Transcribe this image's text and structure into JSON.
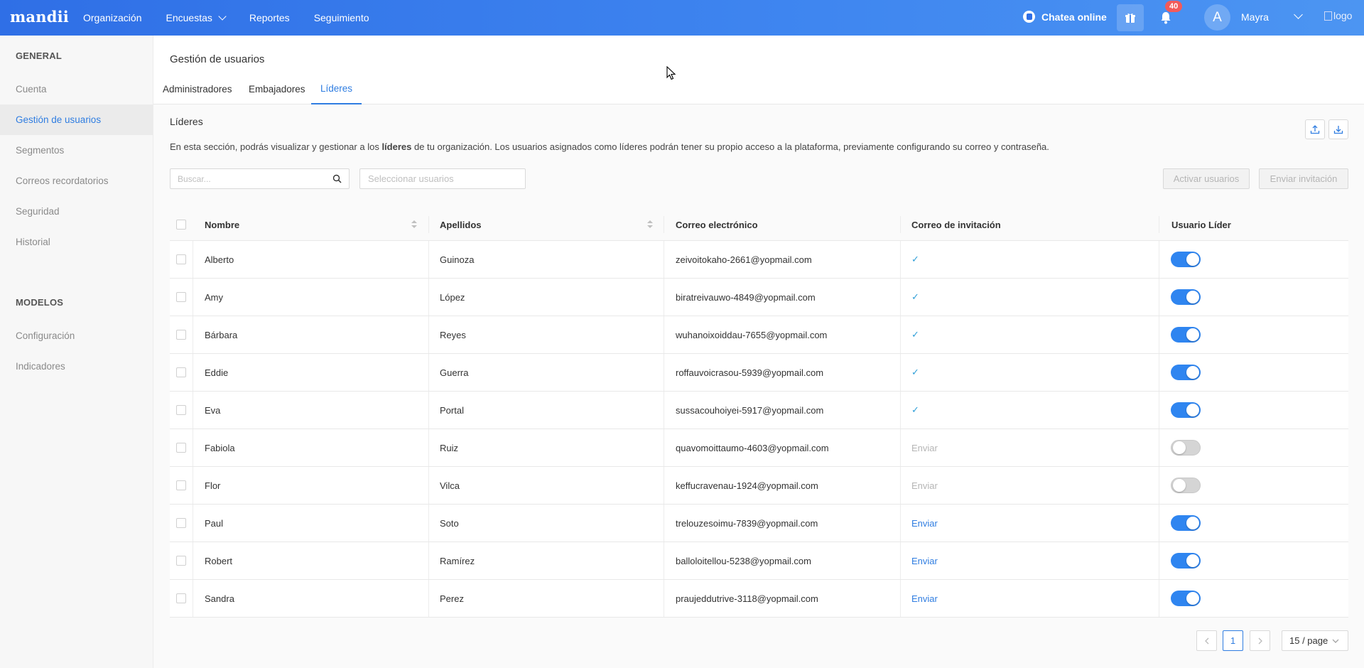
{
  "topbar": {
    "brand": "mandii",
    "nav": [
      {
        "label": "Organización"
      },
      {
        "label": "Encuestas",
        "has_dropdown": true
      },
      {
        "label": "Reportes"
      },
      {
        "label": "Seguimiento"
      }
    ],
    "chat_label": "Chatea online",
    "notification_count": "40",
    "avatar_initial": "A",
    "user_name": "Mayra",
    "logo_alt": "logo"
  },
  "sidebar": {
    "section_general": "GENERAL",
    "general_items": [
      {
        "label": "Cuenta"
      },
      {
        "label": "Gestión de usuarios",
        "active": true
      },
      {
        "label": "Segmentos"
      },
      {
        "label": "Correos recordatorios"
      },
      {
        "label": "Seguridad"
      },
      {
        "label": "Historial"
      }
    ],
    "section_models": "MODELOS",
    "model_items": [
      {
        "label": "Configuración"
      },
      {
        "label": "Indicadores"
      }
    ]
  },
  "main": {
    "page_title": "Gestión de usuarios",
    "tabs": [
      {
        "label": "Administradores"
      },
      {
        "label": "Embajadores"
      },
      {
        "label": "Líderes",
        "active": true
      }
    ],
    "section_title": "Líderes",
    "description_pre": "En esta sección, podrás visualizar y gestionar a los ",
    "description_bold": "líderes",
    "description_post": " de tu organización. Los usuarios asignados como líderes podrán tener su propio acceso a la plataforma, previamente configurando su correo y contraseña.",
    "search_placeholder": "Buscar...",
    "select_placeholder": "Seleccionar usuarios",
    "activate_button": "Activar usuarios",
    "invite_button": "Enviar invitación"
  },
  "table": {
    "columns": [
      "Nombre",
      "Apellidos",
      "Correo electrónico",
      "Correo de invitación",
      "Usuario Líder"
    ],
    "rows": [
      {
        "nombre": "Alberto",
        "apellidos": "Guinoza",
        "correo": "zeivoitokaho-2661@yopmail.com",
        "invitacion": "check",
        "lider": true
      },
      {
        "nombre": "Amy",
        "apellidos": "López",
        "correo": "biratreivauwo-4849@yopmail.com",
        "invitacion": "check",
        "lider": true
      },
      {
        "nombre": "Bárbara",
        "apellidos": "Reyes",
        "correo": "wuhanoixoiddau-7655@yopmail.com",
        "invitacion": "check",
        "lider": true
      },
      {
        "nombre": "Eddie",
        "apellidos": "Guerra",
        "correo": "roffauvoicrasou-5939@yopmail.com",
        "invitacion": "check",
        "lider": true
      },
      {
        "nombre": "Eva",
        "apellidos": "Portal",
        "correo": "sussacouhoiyei-5917@yopmail.com",
        "invitacion": "check",
        "lider": true
      },
      {
        "nombre": "Fabiola",
        "apellidos": "Ruiz",
        "correo": "quavomoittaumo-4603@yopmail.com",
        "invitacion": "Enviar",
        "invitacion_enabled": false,
        "lider": false
      },
      {
        "nombre": "Flor",
        "apellidos": "Vilca",
        "correo": "keffucravenau-1924@yopmail.com",
        "invitacion": "Enviar",
        "invitacion_enabled": false,
        "lider": false
      },
      {
        "nombre": "Paul",
        "apellidos": "Soto",
        "correo": "trelouzesoimu-7839@yopmail.com",
        "invitacion": "Enviar",
        "invitacion_enabled": true,
        "lider": true
      },
      {
        "nombre": "Robert",
        "apellidos": "Ramírez",
        "correo": "balloloitellou-5238@yopmail.com",
        "invitacion": "Enviar",
        "invitacion_enabled": true,
        "lider": true
      },
      {
        "nombre": "Sandra",
        "apellidos": "Perez",
        "correo": "praujeddutrive-3118@yopmail.com",
        "invitacion": "Enviar",
        "invitacion_enabled": true,
        "lider": true
      }
    ]
  },
  "pagination": {
    "current_page": "1",
    "page_size": "15 / page"
  },
  "colors": {
    "accent": "#2f7de1",
    "topbar": "#3f86f0",
    "toggle_on": "#2f85f0",
    "badge": "#f25a5a"
  }
}
